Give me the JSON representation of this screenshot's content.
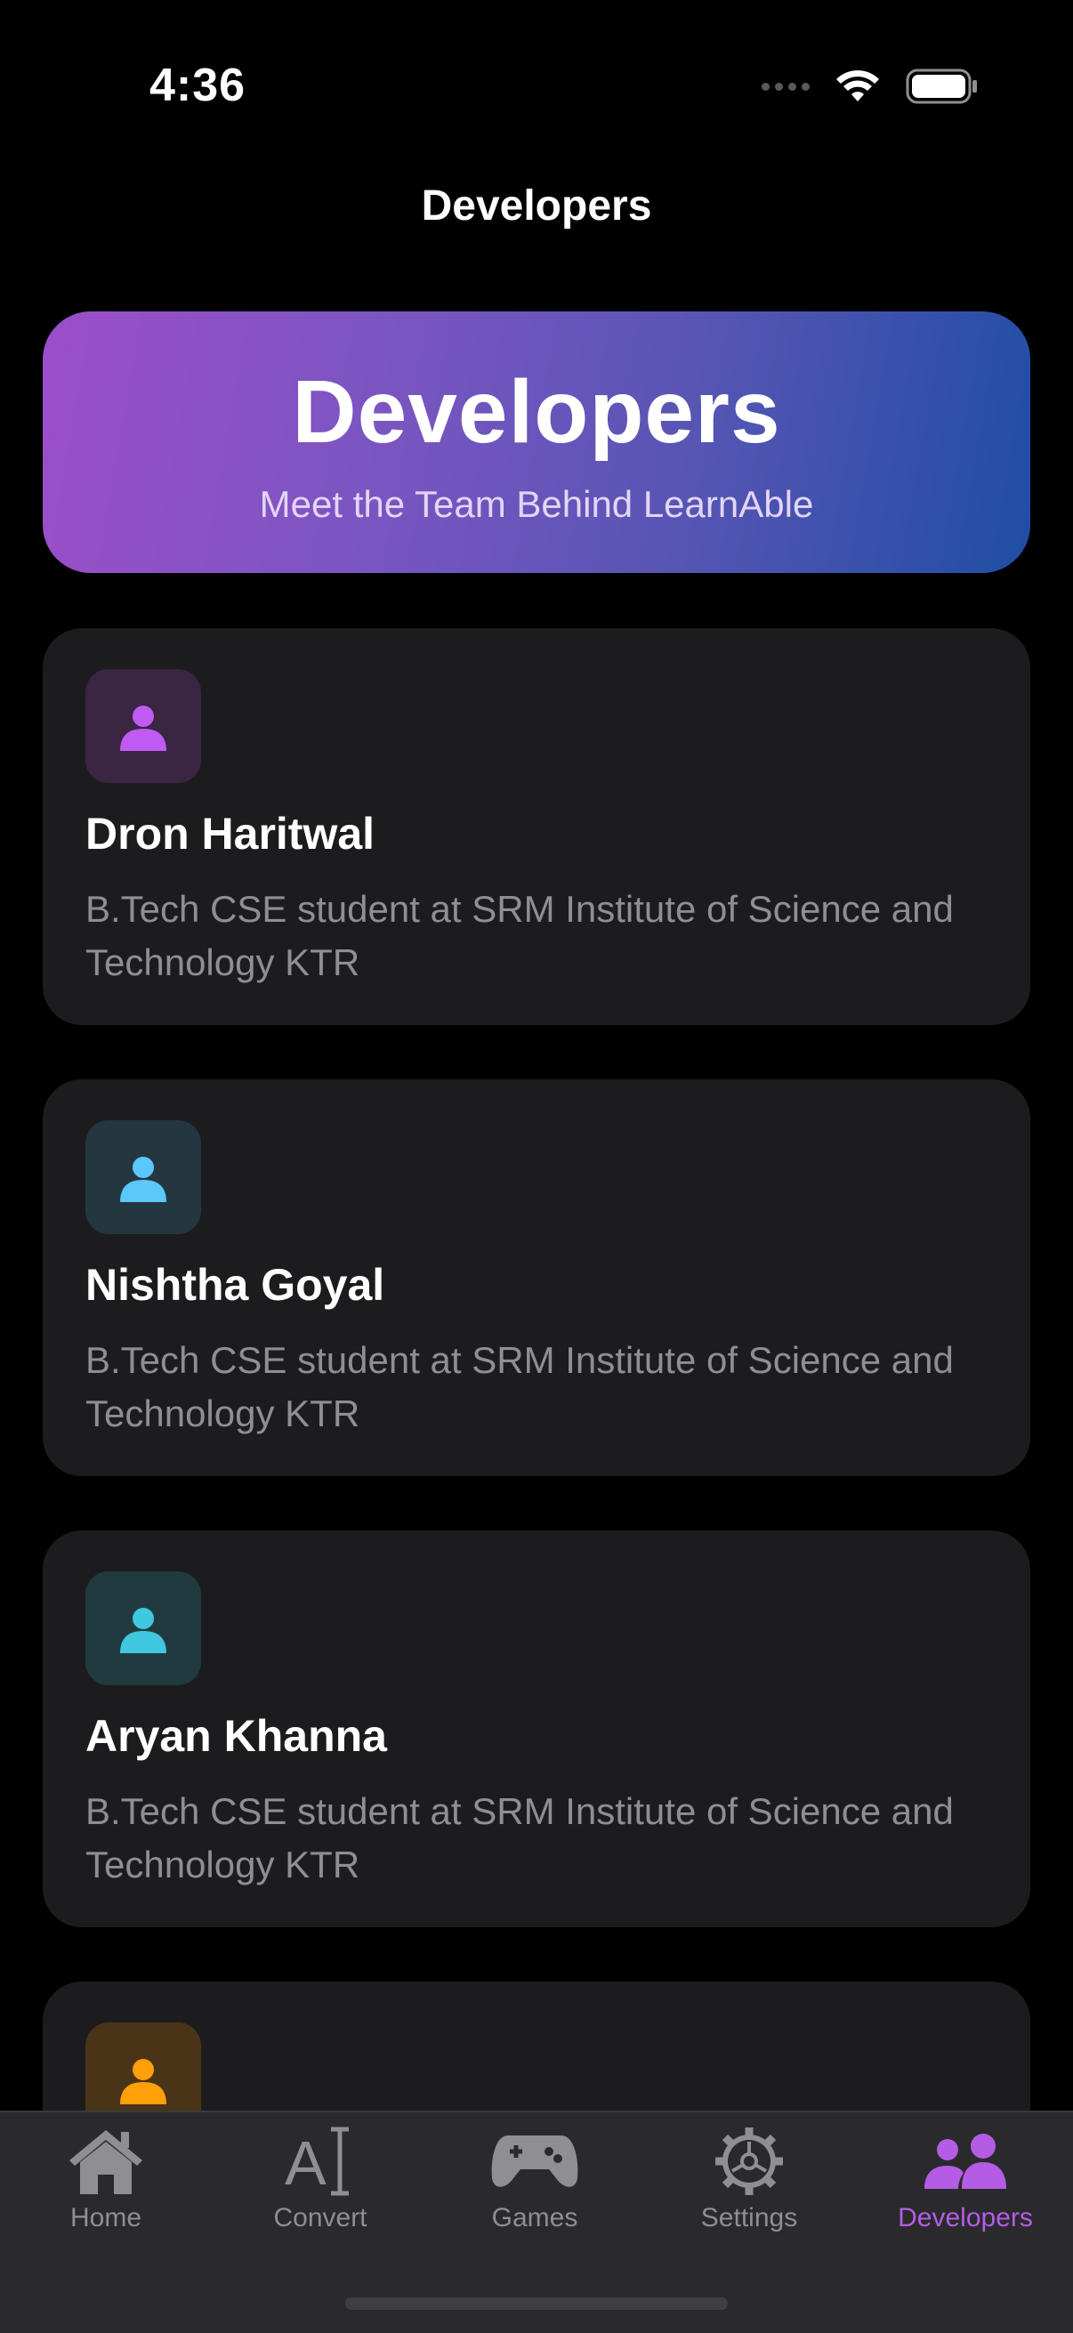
{
  "status_bar": {
    "time": "4:36"
  },
  "nav": {
    "title": "Developers"
  },
  "hero": {
    "title": "Developers",
    "subtitle": "Meet the Team Behind LearnAble"
  },
  "developers": [
    {
      "name": "Dron Haritwal",
      "description": "B.Tech CSE student at SRM Institute of Science and Technology KTR",
      "accent": "#bf5af2",
      "tile": "#3a2542",
      "icon": "person-icon"
    },
    {
      "name": "Nishtha Goyal",
      "description": "B.Tech CSE student at SRM Institute of Science and Technology KTR",
      "accent": "#5ac8fa",
      "tile": "#243640",
      "icon": "person-icon"
    },
    {
      "name": "Aryan Khanna",
      "description": "B.Tech CSE student at SRM Institute of Science and Technology KTR",
      "accent": "#40c8e0",
      "tile": "#213a40",
      "icon": "person-icon"
    },
    {
      "name": "",
      "description": "",
      "accent": "#ff9f0a",
      "tile": "#4a3418",
      "icon": "person-icon"
    }
  ],
  "tab_bar": {
    "tabs": [
      {
        "label": "Home",
        "icon": "house-icon",
        "active": false
      },
      {
        "label": "Convert",
        "icon": "text-cursor-icon",
        "active": false
      },
      {
        "label": "Games",
        "icon": "gamecontroller-icon",
        "active": false
      },
      {
        "label": "Settings",
        "icon": "gear-icon",
        "active": false
      },
      {
        "label": "Developers",
        "icon": "people-icon",
        "active": true
      }
    ],
    "inactive_color": "#8e8e93",
    "active_color": "#b45ce6"
  }
}
